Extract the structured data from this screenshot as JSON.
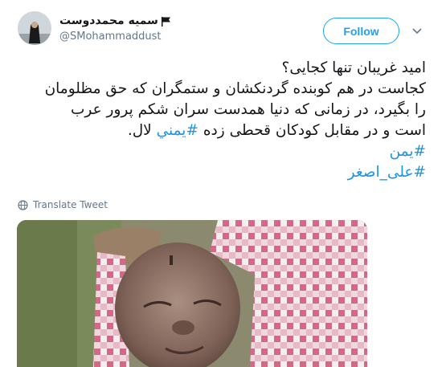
{
  "user": {
    "display_name": "سمیه محمددوست",
    "handle": "@SMohammaddust"
  },
  "follow_label": "Follow",
  "tweet": {
    "line1": "امید غریبان تنها کجایی؟",
    "line2": "کجاست در هم کوبنده گردنکشان و ستمگران که حق مظلومان",
    "line3": "را بگیرد، در زمانی که دنیا همدست سران شکم پرور عرب",
    "line4_pre": "است و در مقابل کودکان قحطی زده",
    "line4_tag": "#یمني",
    "line4_post": "لال.",
    "hashtag1": "#یمن",
    "hashtag2": "#علی_اصغر"
  },
  "translate_label": "Translate Tweet",
  "colors": {
    "accent": "#1da1f2",
    "link": "#1b95e0",
    "text": "#14171a",
    "secondary": "#657786"
  },
  "icons": [
    "avatar",
    "flag-icon",
    "caret-down-icon",
    "globe-icon"
  ]
}
